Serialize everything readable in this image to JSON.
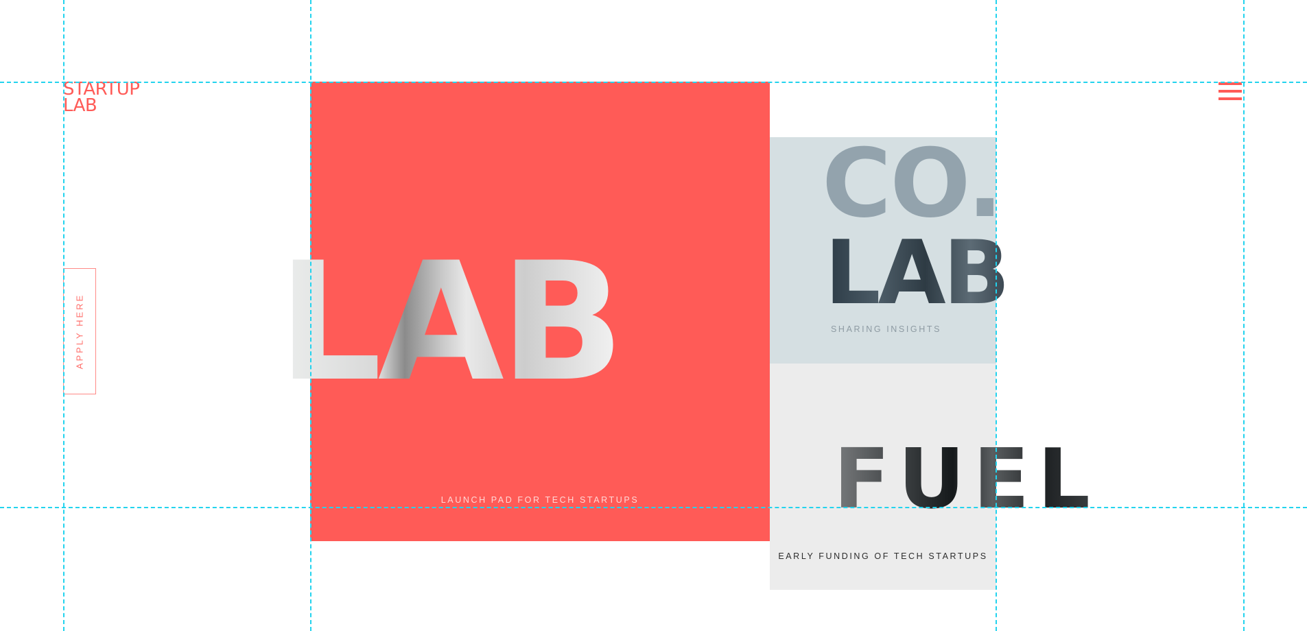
{
  "brand": {
    "logo_line1": "STARTUP",
    "logo_line2": "LAB",
    "accent_color": "#ff5b57"
  },
  "nav": {
    "menu_icon": "hamburger-menu-icon"
  },
  "sidebar": {
    "apply_label": "APPLY HERE"
  },
  "panels": [
    {
      "title": "LAB",
      "caption": "LAUNCH PAD FOR TECH STARTUPS",
      "color": "#ff5b57"
    },
    {
      "title_line1": "CO.",
      "title_line2": "LAB",
      "caption": "SHARING INSIGHTS",
      "color": "#d5dfe2"
    },
    {
      "title": "FUEL",
      "caption": "EARLY FUNDING OF TECH STARTUPS",
      "color": "#ececec"
    }
  ],
  "guides": {
    "color": "#22d3ee"
  }
}
